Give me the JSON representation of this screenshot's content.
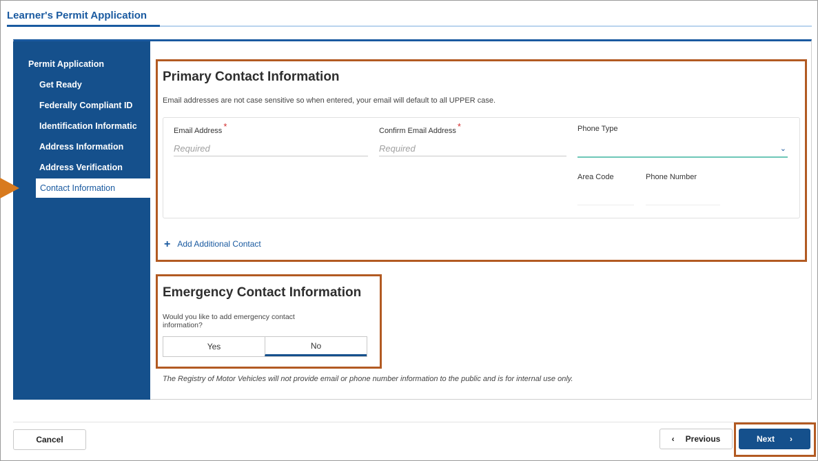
{
  "app": {
    "title": "Learner's Permit Application"
  },
  "sidebar": {
    "heading": "Permit Application",
    "items": [
      {
        "label": "Get Ready"
      },
      {
        "label": "Federally Compliant ID"
      },
      {
        "label": "Identification Informatic"
      },
      {
        "label": "Address Information"
      },
      {
        "label": "Address Verification"
      },
      {
        "label": "Contact Information",
        "active": true
      }
    ]
  },
  "primary_contact": {
    "title": "Primary Contact Information",
    "hint": "Email addresses are not case sensitive so when entered, your email will default to all UPPER case.",
    "email": {
      "label": "Email Address",
      "placeholder": "Required",
      "value": ""
    },
    "confirm_email": {
      "label": "Confirm Email Address",
      "placeholder": "Required",
      "value": ""
    },
    "phone_type": {
      "label": "Phone Type",
      "value": ""
    },
    "area_code": {
      "label": "Area Code",
      "value": ""
    },
    "phone_number": {
      "label": "Phone Number",
      "value": ""
    },
    "required_marker": "*",
    "add_contact": {
      "icon": "+",
      "label": "Add Additional Contact"
    }
  },
  "emergency_contact": {
    "title": "Emergency Contact Information",
    "question": "Would you like to add emergency contact information?",
    "options": [
      {
        "label": "Yes",
        "selected": false
      },
      {
        "label": "No",
        "selected": true
      }
    ]
  },
  "disclaimer": "The Registry of Motor Vehicles will not provide email or phone number information to the public and is for internal use only.",
  "footer": {
    "cancel_label": "Cancel",
    "previous_label": "Previous",
    "next_label": "Next",
    "previous_icon": "‹",
    "next_icon": "›"
  },
  "colors": {
    "brand_blue": "#15508c",
    "highlight_orange": "#b25a22",
    "arrow_orange": "#d87a1e",
    "select_accent": "#6dc7b7",
    "required_red": "#d32f2f"
  }
}
